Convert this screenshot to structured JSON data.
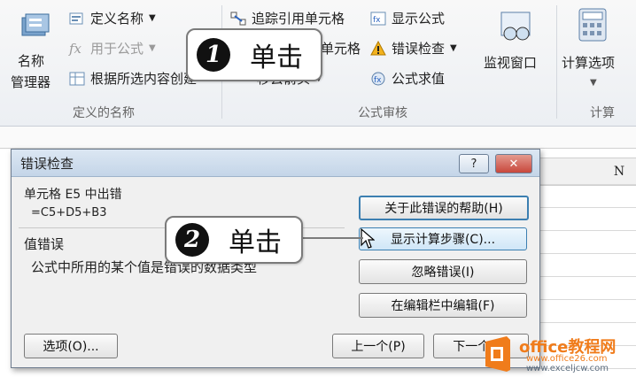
{
  "ribbon": {
    "defined_names": {
      "name_manager_line1": "名称",
      "name_manager_line2": "管理器",
      "define_name": "定义名称",
      "use_in_formula": "用于公式",
      "create_from_selection": "根据所选内容创建",
      "group_label": "定义的名称"
    },
    "formula_auditing": {
      "trace_precedents": "追踪引用单元格",
      "trace_dependents_partial": "单元格",
      "remove_arrows_partial": "移去箭头",
      "show_formulas": "显示公式",
      "error_checking": "错误检查",
      "evaluate_formula": "公式求值",
      "group_label": "公式审核"
    },
    "watch_window": "监视窗口",
    "calc_options": "计算选项",
    "calc_group_label": "计算"
  },
  "sheet": {
    "column_n": "N"
  },
  "dialog": {
    "title": "错误检查",
    "help_glyph": "?",
    "close_glyph": "✕",
    "cell_error_heading": "单元格 E5 中出错",
    "formula": "=C5+D5+B3",
    "error_type": "值错误",
    "error_description": "公式中所用的某个值是错误的数据类型",
    "buttons": {
      "help": "关于此错误的帮助(H)",
      "show_calc_steps": "显示计算步骤(C)...",
      "ignore_error": "忽略错误(I)",
      "edit_in_formula_bar": "在编辑栏中编辑(F)",
      "options": "选项(O)...",
      "previous": "上一个(P)",
      "next": "下一个(N)"
    }
  },
  "callouts": [
    {
      "number": "1",
      "text": "单击"
    },
    {
      "number": "2",
      "text": "单击"
    }
  ],
  "watermark": {
    "brand": "office教程网",
    "url1": "www.office26.com",
    "url2": "www.exceljcw.com"
  },
  "colors": {
    "ribbon_bg": "#eceff3",
    "dialog_title_bg": "#c4d5e8",
    "close_button": "#c8473c",
    "watermark_orange": "#f07c1b"
  }
}
